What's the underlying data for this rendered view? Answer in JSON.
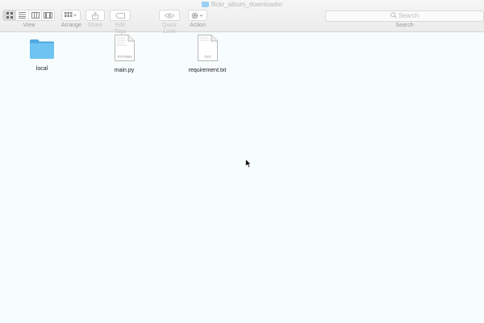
{
  "window": {
    "title": "flickr_album_downloader"
  },
  "toolbar": {
    "view_label": "View",
    "arrange_label": "Arrange",
    "share_label": "Share",
    "edit_tags_label": "Edit Tags",
    "quick_look_label": "Quick Look",
    "action_label": "Action",
    "search_placeholder": "Search",
    "search_label": "Search"
  },
  "files": [
    {
      "name": "local",
      "kind": "folder"
    },
    {
      "name": "main.py",
      "kind": "document",
      "badge": "PYTHON"
    },
    {
      "name": "requirement.txt",
      "kind": "document",
      "badge": "TXT"
    }
  ],
  "colors": {
    "folder": "#6ec3f3",
    "content_bg": "#f7fcfc",
    "toolbar_bg": "#ececec"
  }
}
